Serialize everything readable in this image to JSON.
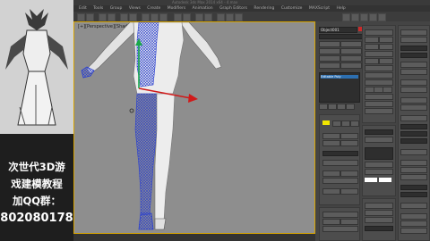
{
  "titlebar": {
    "text": "Autodesk 3ds Max 2014 x64 - 4.max"
  },
  "menu": {
    "items": [
      "Edit",
      "Tools",
      "Group",
      "Views",
      "Create",
      "Modifiers",
      "Animation",
      "Graph Editors",
      "Rendering",
      "Customize",
      "MAXScript",
      "Help"
    ]
  },
  "viewport": {
    "label": "[+][Perspective][Shaded]"
  },
  "panel": {
    "object_name": "Object001",
    "modifier_item": "Editable Poly",
    "colors": {
      "selected_color": "#f2e600",
      "highlight": "#cc2a2a",
      "accent": "#2d6fb0"
    }
  },
  "promo": {
    "line1": "次世代3D游",
    "line2": "戏建模教程",
    "line3": "加QQ群：",
    "line4": "802080178"
  },
  "colors": {
    "viewport_bg": "#8e8e8e",
    "viewport_border": "#d7a400",
    "panel_bg": "#444444",
    "gizmo_x": "#d01a1a",
    "gizmo_y": "#1aa84a"
  }
}
